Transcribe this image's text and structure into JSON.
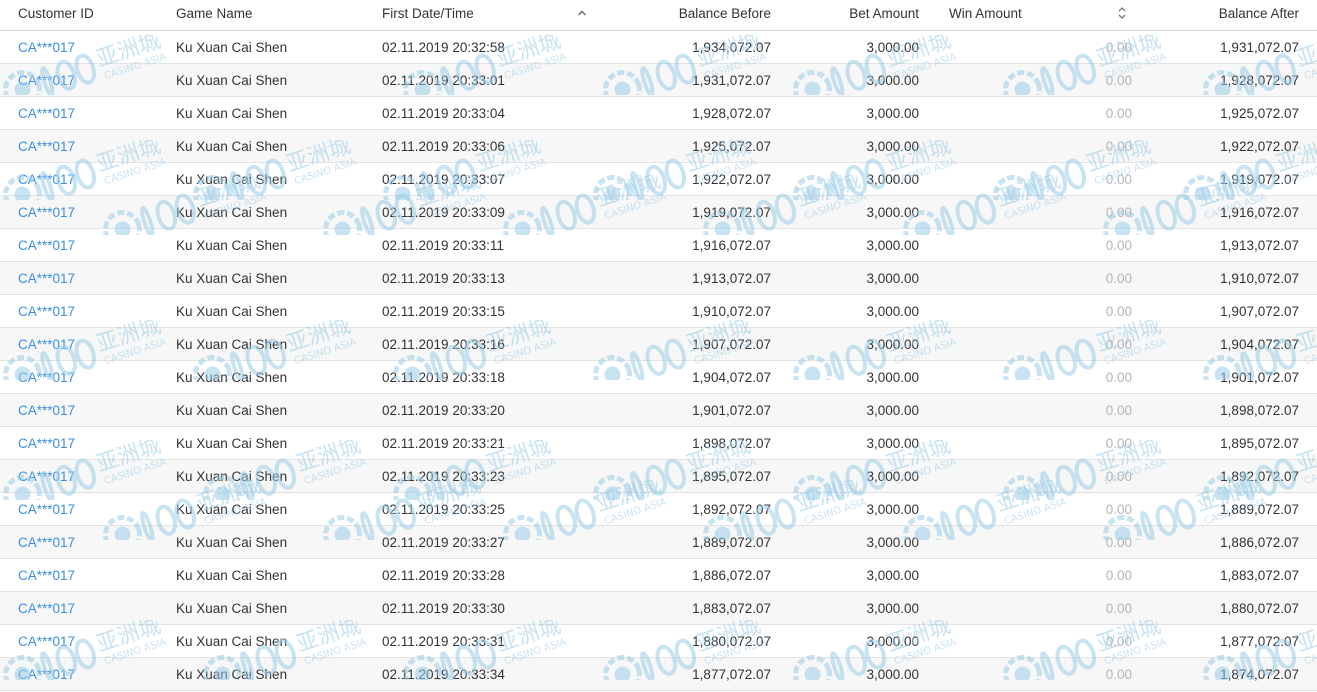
{
  "columns": {
    "customer_id": "Customer ID",
    "game_name": "Game Name",
    "first_datetime": "First Date/Time",
    "balance_before": "Balance Before",
    "bet_amount": "Bet Amount",
    "win_amount": "Win Amount",
    "balance_after": "Balance After"
  },
  "sort_state": {
    "first_datetime": "ascending",
    "win_amount": "unsorted"
  },
  "watermark": {
    "brand": "C188",
    "chinese": "亚洲城",
    "english": "CASINO ASIA"
  },
  "colors": {
    "link": "#3a8ee6",
    "watermark": "#9ccde8",
    "muted_value": "#b5b5b5"
  },
  "rows": [
    {
      "customer_id": "CA***017",
      "game_name": "Ku Xuan Cai Shen",
      "first_datetime": "02.11.2019 20:32:58",
      "balance_before": "1,934,072.07",
      "bet_amount": "3,000.00",
      "win_amount": "0.00",
      "balance_after": "1,931,072.07"
    },
    {
      "customer_id": "CA***017",
      "game_name": "Ku Xuan Cai Shen",
      "first_datetime": "02.11.2019 20:33:01",
      "balance_before": "1,931,072.07",
      "bet_amount": "3,000.00",
      "win_amount": "0.00",
      "balance_after": "1,928,072.07"
    },
    {
      "customer_id": "CA***017",
      "game_name": "Ku Xuan Cai Shen",
      "first_datetime": "02.11.2019 20:33:04",
      "balance_before": "1,928,072.07",
      "bet_amount": "3,000.00",
      "win_amount": "0.00",
      "balance_after": "1,925,072.07"
    },
    {
      "customer_id": "CA***017",
      "game_name": "Ku Xuan Cai Shen",
      "first_datetime": "02.11.2019 20:33:06",
      "balance_before": "1,925,072.07",
      "bet_amount": "3,000.00",
      "win_amount": "0.00",
      "balance_after": "1,922,072.07"
    },
    {
      "customer_id": "CA***017",
      "game_name": "Ku Xuan Cai Shen",
      "first_datetime": "02.11.2019 20:33:07",
      "balance_before": "1,922,072.07",
      "bet_amount": "3,000.00",
      "win_amount": "0.00",
      "balance_after": "1,919,072.07"
    },
    {
      "customer_id": "CA***017",
      "game_name": "Ku Xuan Cai Shen",
      "first_datetime": "02.11.2019 20:33:09",
      "balance_before": "1,919,072.07",
      "bet_amount": "3,000.00",
      "win_amount": "0.00",
      "balance_after": "1,916,072.07"
    },
    {
      "customer_id": "CA***017",
      "game_name": "Ku Xuan Cai Shen",
      "first_datetime": "02.11.2019 20:33:11",
      "balance_before": "1,916,072.07",
      "bet_amount": "3,000.00",
      "win_amount": "0.00",
      "balance_after": "1,913,072.07"
    },
    {
      "customer_id": "CA***017",
      "game_name": "Ku Xuan Cai Shen",
      "first_datetime": "02.11.2019 20:33:13",
      "balance_before": "1,913,072.07",
      "bet_amount": "3,000.00",
      "win_amount": "0.00",
      "balance_after": "1,910,072.07"
    },
    {
      "customer_id": "CA***017",
      "game_name": "Ku Xuan Cai Shen",
      "first_datetime": "02.11.2019 20:33:15",
      "balance_before": "1,910,072.07",
      "bet_amount": "3,000.00",
      "win_amount": "0.00",
      "balance_after": "1,907,072.07"
    },
    {
      "customer_id": "CA***017",
      "game_name": "Ku Xuan Cai Shen",
      "first_datetime": "02.11.2019 20:33:16",
      "balance_before": "1,907,072.07",
      "bet_amount": "3,000.00",
      "win_amount": "0.00",
      "balance_after": "1,904,072.07"
    },
    {
      "customer_id": "CA***017",
      "game_name": "Ku Xuan Cai Shen",
      "first_datetime": "02.11.2019 20:33:18",
      "balance_before": "1,904,072.07",
      "bet_amount": "3,000.00",
      "win_amount": "0.00",
      "balance_after": "1,901,072.07"
    },
    {
      "customer_id": "CA***017",
      "game_name": "Ku Xuan Cai Shen",
      "first_datetime": "02.11.2019 20:33:20",
      "balance_before": "1,901,072.07",
      "bet_amount": "3,000.00",
      "win_amount": "0.00",
      "balance_after": "1,898,072.07"
    },
    {
      "customer_id": "CA***017",
      "game_name": "Ku Xuan Cai Shen",
      "first_datetime": "02.11.2019 20:33:21",
      "balance_before": "1,898,072.07",
      "bet_amount": "3,000.00",
      "win_amount": "0.00",
      "balance_after": "1,895,072.07"
    },
    {
      "customer_id": "CA***017",
      "game_name": "Ku Xuan Cai Shen",
      "first_datetime": "02.11.2019 20:33:23",
      "balance_before": "1,895,072.07",
      "bet_amount": "3,000.00",
      "win_amount": "0.00",
      "balance_after": "1,892,072.07"
    },
    {
      "customer_id": "CA***017",
      "game_name": "Ku Xuan Cai Shen",
      "first_datetime": "02.11.2019 20:33:25",
      "balance_before": "1,892,072.07",
      "bet_amount": "3,000.00",
      "win_amount": "0.00",
      "balance_after": "1,889,072.07"
    },
    {
      "customer_id": "CA***017",
      "game_name": "Ku Xuan Cai Shen",
      "first_datetime": "02.11.2019 20:33:27",
      "balance_before": "1,889,072.07",
      "bet_amount": "3,000.00",
      "win_amount": "0.00",
      "balance_after": "1,886,072.07"
    },
    {
      "customer_id": "CA***017",
      "game_name": "Ku Xuan Cai Shen",
      "first_datetime": "02.11.2019 20:33:28",
      "balance_before": "1,886,072.07",
      "bet_amount": "3,000.00",
      "win_amount": "0.00",
      "balance_after": "1,883,072.07"
    },
    {
      "customer_id": "CA***017",
      "game_name": "Ku Xuan Cai Shen",
      "first_datetime": "02.11.2019 20:33:30",
      "balance_before": "1,883,072.07",
      "bet_amount": "3,000.00",
      "win_amount": "0.00",
      "balance_after": "1,880,072.07"
    },
    {
      "customer_id": "CA***017",
      "game_name": "Ku Xuan Cai Shen",
      "first_datetime": "02.11.2019 20:33:31",
      "balance_before": "1,880,072.07",
      "bet_amount": "3,000.00",
      "win_amount": "0.00",
      "balance_after": "1,877,072.07"
    },
    {
      "customer_id": "CA***017",
      "game_name": "Ku Xuan Cai Shen",
      "first_datetime": "02.11.2019 20:33:34",
      "balance_before": "1,877,072.07",
      "bet_amount": "3,000.00",
      "win_amount": "0.00",
      "balance_after": "1,874,072.07"
    }
  ]
}
